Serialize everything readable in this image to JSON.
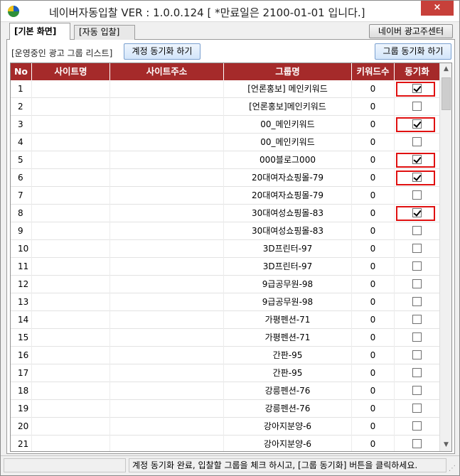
{
  "window": {
    "title": "네이버자동입찰 VER : 1.0.0.124  [ *만료일은 2100-01-01 입니다.]",
    "close_label": "×"
  },
  "tabs": [
    {
      "label": "[기본 화면]",
      "active": true
    },
    {
      "label": "[자동 입찰]",
      "active": false
    }
  ],
  "toolbar": {
    "ad_center_label": "네이버 광고주센터",
    "list_label": "[운영중인 광고 그룹 리스트]",
    "sync_account_label": "계정 동기화 하기",
    "sync_group_label": "그룹 동기화 하기"
  },
  "table": {
    "headers": [
      "No",
      "사이트명",
      "사이트주소",
      "그룹명",
      "키워드수",
      "동기화"
    ],
    "rows": [
      {
        "no": "1",
        "site": "",
        "address": "",
        "group": "[언론홍보] 메인키워드",
        "keywords": "0",
        "checked": true,
        "highlight": true
      },
      {
        "no": "2",
        "site": "",
        "address": "",
        "group": "[언론홍보]메인키워드",
        "keywords": "0",
        "checked": false,
        "highlight": false
      },
      {
        "no": "3",
        "site": "",
        "address": "",
        "group": "00_메인키워드",
        "keywords": "0",
        "checked": true,
        "highlight": true
      },
      {
        "no": "4",
        "site": "",
        "address": "",
        "group": "00_메인키워드",
        "keywords": "0",
        "checked": false,
        "highlight": false
      },
      {
        "no": "5",
        "site": "",
        "address": "",
        "group": "000블로그000",
        "keywords": "0",
        "checked": true,
        "highlight": true
      },
      {
        "no": "6",
        "site": "",
        "address": "",
        "group": "20대여자쇼핑몰-79",
        "keywords": "0",
        "checked": true,
        "highlight": true
      },
      {
        "no": "7",
        "site": "",
        "address": "",
        "group": "20대여자쇼핑몰-79",
        "keywords": "0",
        "checked": false,
        "highlight": false
      },
      {
        "no": "8",
        "site": "",
        "address": "",
        "group": "30대여성쇼핑몰-83",
        "keywords": "0",
        "checked": true,
        "highlight": true
      },
      {
        "no": "9",
        "site": "",
        "address": "",
        "group": "30대여성쇼핑몰-83",
        "keywords": "0",
        "checked": false,
        "highlight": false
      },
      {
        "no": "10",
        "site": "",
        "address": "",
        "group": "3D프린터-97",
        "keywords": "0",
        "checked": false,
        "highlight": false
      },
      {
        "no": "11",
        "site": "",
        "address": "",
        "group": "3D프린터-97",
        "keywords": "0",
        "checked": false,
        "highlight": false
      },
      {
        "no": "12",
        "site": "",
        "address": "",
        "group": "9급공무원-98",
        "keywords": "0",
        "checked": false,
        "highlight": false
      },
      {
        "no": "13",
        "site": "",
        "address": "",
        "group": "9급공무원-98",
        "keywords": "0",
        "checked": false,
        "highlight": false
      },
      {
        "no": "14",
        "site": "",
        "address": "",
        "group": "가평펜션-71",
        "keywords": "0",
        "checked": false,
        "highlight": false
      },
      {
        "no": "15",
        "site": "",
        "address": "",
        "group": "가평펜션-71",
        "keywords": "0",
        "checked": false,
        "highlight": false
      },
      {
        "no": "16",
        "site": "",
        "address": "",
        "group": "간판-95",
        "keywords": "0",
        "checked": false,
        "highlight": false
      },
      {
        "no": "17",
        "site": "",
        "address": "",
        "group": "간판-95",
        "keywords": "0",
        "checked": false,
        "highlight": false
      },
      {
        "no": "18",
        "site": "",
        "address": "",
        "group": "강릉펜션-76",
        "keywords": "0",
        "checked": false,
        "highlight": false
      },
      {
        "no": "19",
        "site": "",
        "address": "",
        "group": "강릉펜션-76",
        "keywords": "0",
        "checked": false,
        "highlight": false
      },
      {
        "no": "20",
        "site": "",
        "address": "",
        "group": "강아지분양-6",
        "keywords": "0",
        "checked": false,
        "highlight": false
      },
      {
        "no": "21",
        "site": "",
        "address": "",
        "group": "강아지분양-6",
        "keywords": "0",
        "checked": false,
        "highlight": false
      }
    ]
  },
  "status": {
    "message": "계정 동기화 완료, 입찰할 그룹을 체크 하시고, [그룹 동기화] 버튼을 클릭하세요."
  },
  "colors": {
    "header_bg": "#a52a2a",
    "highlight_border": "#e01010"
  }
}
